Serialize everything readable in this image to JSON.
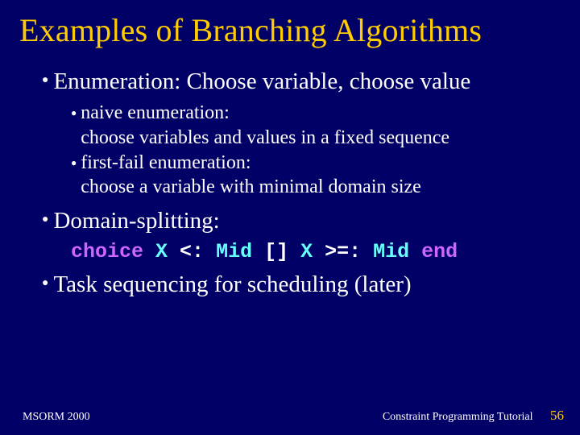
{
  "title": "Examples of Branching Algorithms",
  "bullets": {
    "b1": "Enumeration:  Choose variable, choose value",
    "b1_sub1_a": "naive enumeration:",
    "b1_sub1_b": "choose variables and values in a fixed sequence",
    "b1_sub2_a": "first-fail enumeration:",
    "b1_sub2_b": "choose a variable with minimal domain size",
    "b2": "Domain-splitting:",
    "b3": "Task sequencing for scheduling (later)"
  },
  "code": {
    "kw1": "choice",
    "v1": "X",
    "r1": " <: ",
    "v2": "Mid",
    "r2": " [] ",
    "v3": "X",
    "r3": " >=: ",
    "v4": "Mid",
    "sp": " ",
    "kw2": "end"
  },
  "footer": {
    "left": "MSORM 2000",
    "right": "Constraint Programming Tutorial",
    "page": "56"
  }
}
